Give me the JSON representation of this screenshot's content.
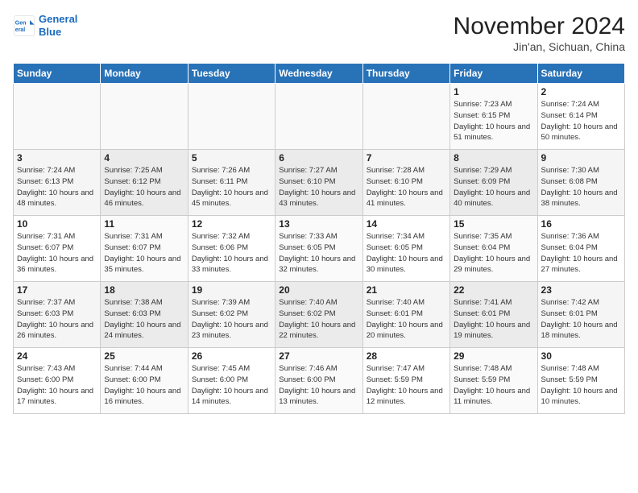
{
  "header": {
    "logo_line1": "General",
    "logo_line2": "Blue",
    "month_title": "November 2024",
    "location": "Jin'an, Sichuan, China"
  },
  "weekdays": [
    "Sunday",
    "Monday",
    "Tuesday",
    "Wednesday",
    "Thursday",
    "Friday",
    "Saturday"
  ],
  "weeks": [
    [
      {
        "day": "",
        "info": ""
      },
      {
        "day": "",
        "info": ""
      },
      {
        "day": "",
        "info": ""
      },
      {
        "day": "",
        "info": ""
      },
      {
        "day": "",
        "info": ""
      },
      {
        "day": "1",
        "info": "Sunrise: 7:23 AM\nSunset: 6:15 PM\nDaylight: 10 hours\nand 51 minutes."
      },
      {
        "day": "2",
        "info": "Sunrise: 7:24 AM\nSunset: 6:14 PM\nDaylight: 10 hours\nand 50 minutes."
      }
    ],
    [
      {
        "day": "3",
        "info": "Sunrise: 7:24 AM\nSunset: 6:13 PM\nDaylight: 10 hours\nand 48 minutes."
      },
      {
        "day": "4",
        "info": "Sunrise: 7:25 AM\nSunset: 6:12 PM\nDaylight: 10 hours\nand 46 minutes."
      },
      {
        "day": "5",
        "info": "Sunrise: 7:26 AM\nSunset: 6:11 PM\nDaylight: 10 hours\nand 45 minutes."
      },
      {
        "day": "6",
        "info": "Sunrise: 7:27 AM\nSunset: 6:10 PM\nDaylight: 10 hours\nand 43 minutes."
      },
      {
        "day": "7",
        "info": "Sunrise: 7:28 AM\nSunset: 6:10 PM\nDaylight: 10 hours\nand 41 minutes."
      },
      {
        "day": "8",
        "info": "Sunrise: 7:29 AM\nSunset: 6:09 PM\nDaylight: 10 hours\nand 40 minutes."
      },
      {
        "day": "9",
        "info": "Sunrise: 7:30 AM\nSunset: 6:08 PM\nDaylight: 10 hours\nand 38 minutes."
      }
    ],
    [
      {
        "day": "10",
        "info": "Sunrise: 7:31 AM\nSunset: 6:07 PM\nDaylight: 10 hours\nand 36 minutes."
      },
      {
        "day": "11",
        "info": "Sunrise: 7:31 AM\nSunset: 6:07 PM\nDaylight: 10 hours\nand 35 minutes."
      },
      {
        "day": "12",
        "info": "Sunrise: 7:32 AM\nSunset: 6:06 PM\nDaylight: 10 hours\nand 33 minutes."
      },
      {
        "day": "13",
        "info": "Sunrise: 7:33 AM\nSunset: 6:05 PM\nDaylight: 10 hours\nand 32 minutes."
      },
      {
        "day": "14",
        "info": "Sunrise: 7:34 AM\nSunset: 6:05 PM\nDaylight: 10 hours\nand 30 minutes."
      },
      {
        "day": "15",
        "info": "Sunrise: 7:35 AM\nSunset: 6:04 PM\nDaylight: 10 hours\nand 29 minutes."
      },
      {
        "day": "16",
        "info": "Sunrise: 7:36 AM\nSunset: 6:04 PM\nDaylight: 10 hours\nand 27 minutes."
      }
    ],
    [
      {
        "day": "17",
        "info": "Sunrise: 7:37 AM\nSunset: 6:03 PM\nDaylight: 10 hours\nand 26 minutes."
      },
      {
        "day": "18",
        "info": "Sunrise: 7:38 AM\nSunset: 6:03 PM\nDaylight: 10 hours\nand 24 minutes."
      },
      {
        "day": "19",
        "info": "Sunrise: 7:39 AM\nSunset: 6:02 PM\nDaylight: 10 hours\nand 23 minutes."
      },
      {
        "day": "20",
        "info": "Sunrise: 7:40 AM\nSunset: 6:02 PM\nDaylight: 10 hours\nand 22 minutes."
      },
      {
        "day": "21",
        "info": "Sunrise: 7:40 AM\nSunset: 6:01 PM\nDaylight: 10 hours\nand 20 minutes."
      },
      {
        "day": "22",
        "info": "Sunrise: 7:41 AM\nSunset: 6:01 PM\nDaylight: 10 hours\nand 19 minutes."
      },
      {
        "day": "23",
        "info": "Sunrise: 7:42 AM\nSunset: 6:01 PM\nDaylight: 10 hours\nand 18 minutes."
      }
    ],
    [
      {
        "day": "24",
        "info": "Sunrise: 7:43 AM\nSunset: 6:00 PM\nDaylight: 10 hours\nand 17 minutes."
      },
      {
        "day": "25",
        "info": "Sunrise: 7:44 AM\nSunset: 6:00 PM\nDaylight: 10 hours\nand 16 minutes."
      },
      {
        "day": "26",
        "info": "Sunrise: 7:45 AM\nSunset: 6:00 PM\nDaylight: 10 hours\nand 14 minutes."
      },
      {
        "day": "27",
        "info": "Sunrise: 7:46 AM\nSunset: 6:00 PM\nDaylight: 10 hours\nand 13 minutes."
      },
      {
        "day": "28",
        "info": "Sunrise: 7:47 AM\nSunset: 5:59 PM\nDaylight: 10 hours\nand 12 minutes."
      },
      {
        "day": "29",
        "info": "Sunrise: 7:48 AM\nSunset: 5:59 PM\nDaylight: 10 hours\nand 11 minutes."
      },
      {
        "day": "30",
        "info": "Sunrise: 7:48 AM\nSunset: 5:59 PM\nDaylight: 10 hours\nand 10 minutes."
      }
    ]
  ]
}
